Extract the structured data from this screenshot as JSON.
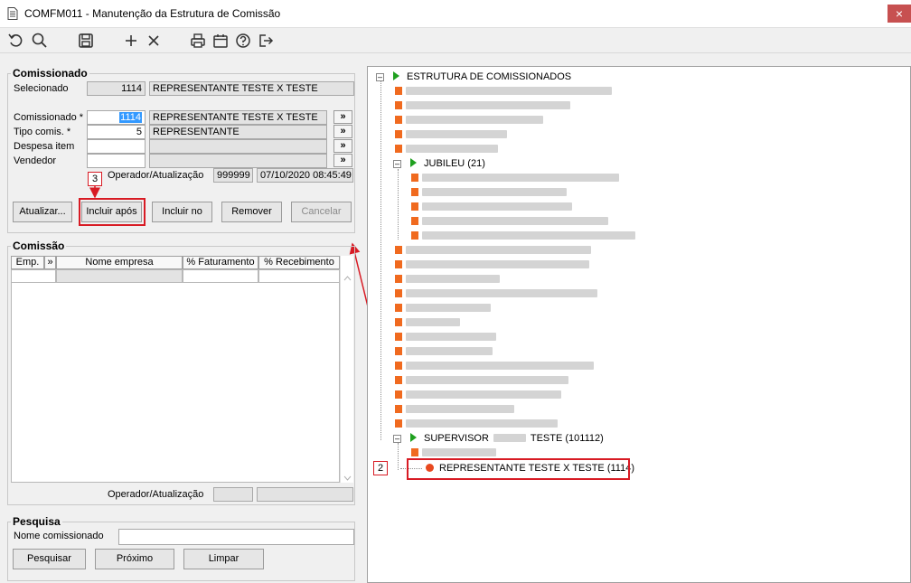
{
  "window": {
    "title": "COMFM011 - Manutenção da Estrutura de Comissão",
    "close": "×"
  },
  "toolbar_icons": [
    "undo-icon",
    "search-icon",
    "save-icon",
    "add-icon",
    "delete-icon",
    "print-icon",
    "calendar-icon",
    "help-icon",
    "exit-icon"
  ],
  "comissionado": {
    "group_title": "Comissionado",
    "selecionado_label": "Selecionado",
    "selecionado_code": "1114",
    "selecionado_name": "REPRESENTANTE TESTE X TESTE",
    "comissionado_label": "Comissionado *",
    "comissionado_code": "1114",
    "comissionado_name": "REPRESENTANTE TESTE X TESTE",
    "tipo_label": "Tipo comis. *",
    "tipo_code": "5",
    "tipo_name": "REPRESENTANTE",
    "despesa_label": "Despesa item",
    "vendedor_label": "Vendedor",
    "lookup_glyph": "»",
    "operador_label": "Operador/Atualização",
    "operador_code": "999999",
    "operador_date": "07/10/2020 08:45:49",
    "buttons": {
      "atualizar": "Atualizar...",
      "incluir_apos": "Incluir após",
      "incluir_no": "Incluir no",
      "remover": "Remover",
      "cancelar": "Cancelar"
    }
  },
  "comissao": {
    "group_title": "Comissão",
    "columns": [
      "Emp.",
      "»",
      "Nome empresa",
      "% Faturamento",
      "% Recebimento"
    ],
    "operador_label": "Operador/Atualização"
  },
  "pesquisa": {
    "group_title": "Pesquisa",
    "nome_label": "Nome comissionado",
    "nome_value": "",
    "buttons": {
      "pesquisar": "Pesquisar",
      "proximo": "Próximo",
      "limpar": "Limpar"
    }
  },
  "tree": {
    "root": "ESTRUTURA DE COMISSIONADOS",
    "jubileu": "JUBILEU (21)",
    "supervisor_prefix": "SUPERVISOR",
    "supervisor_suffix": "TESTE (101112)",
    "selected": "REPRESENTANTE TESTE X TESTE (1114)"
  },
  "annotations": {
    "step2": "2",
    "step3": "3"
  },
  "colors": {
    "accent": "#d81b24",
    "node_orange": "#f06a1f",
    "node_green": "#1fa01f",
    "selection": "#3399ff"
  }
}
